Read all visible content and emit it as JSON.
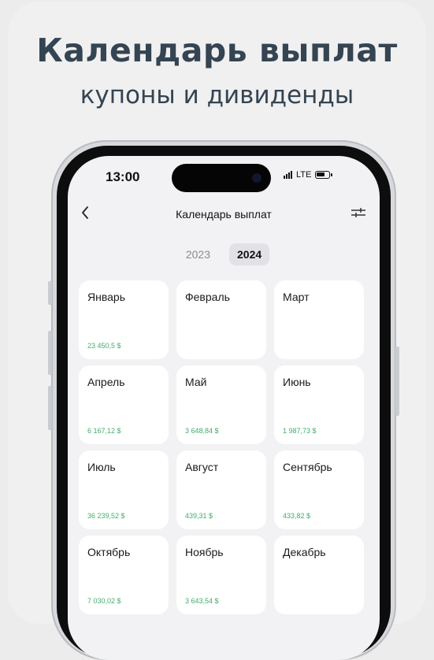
{
  "hero": {
    "title": "Календарь выплат",
    "subtitle": "купоны и дивиденды"
  },
  "status_bar": {
    "time": "13:00",
    "network": "LTE"
  },
  "nav": {
    "title": "Календарь выплат"
  },
  "years": [
    {
      "label": "2023",
      "active": false
    },
    {
      "label": "2024",
      "active": true
    }
  ],
  "months": [
    {
      "name": "Январь",
      "amount": "23 450,5 $"
    },
    {
      "name": "Февраль",
      "amount": ""
    },
    {
      "name": "Март",
      "amount": ""
    },
    {
      "name": "Апрель",
      "amount": "6 167,12 $"
    },
    {
      "name": "Май",
      "amount": "3 648,84 $"
    },
    {
      "name": "Июнь",
      "amount": "1 987,73 $"
    },
    {
      "name": "Июль",
      "amount": "36 239,52 $"
    },
    {
      "name": "Август",
      "amount": "439,31 $"
    },
    {
      "name": "Сентябрь",
      "amount": "433,82 $"
    },
    {
      "name": "Октябрь",
      "amount": "7 030,02 $"
    },
    {
      "name": "Ноябрь",
      "amount": "3 643,54 $"
    },
    {
      "name": "Декабрь",
      "amount": ""
    }
  ],
  "colors": {
    "amount_green": "#3fae6b",
    "title_dark": "#354452"
  },
  "icons": [
    "back-chevron-icon",
    "filter-sliders-icon",
    "signal-icon",
    "battery-icon"
  ]
}
